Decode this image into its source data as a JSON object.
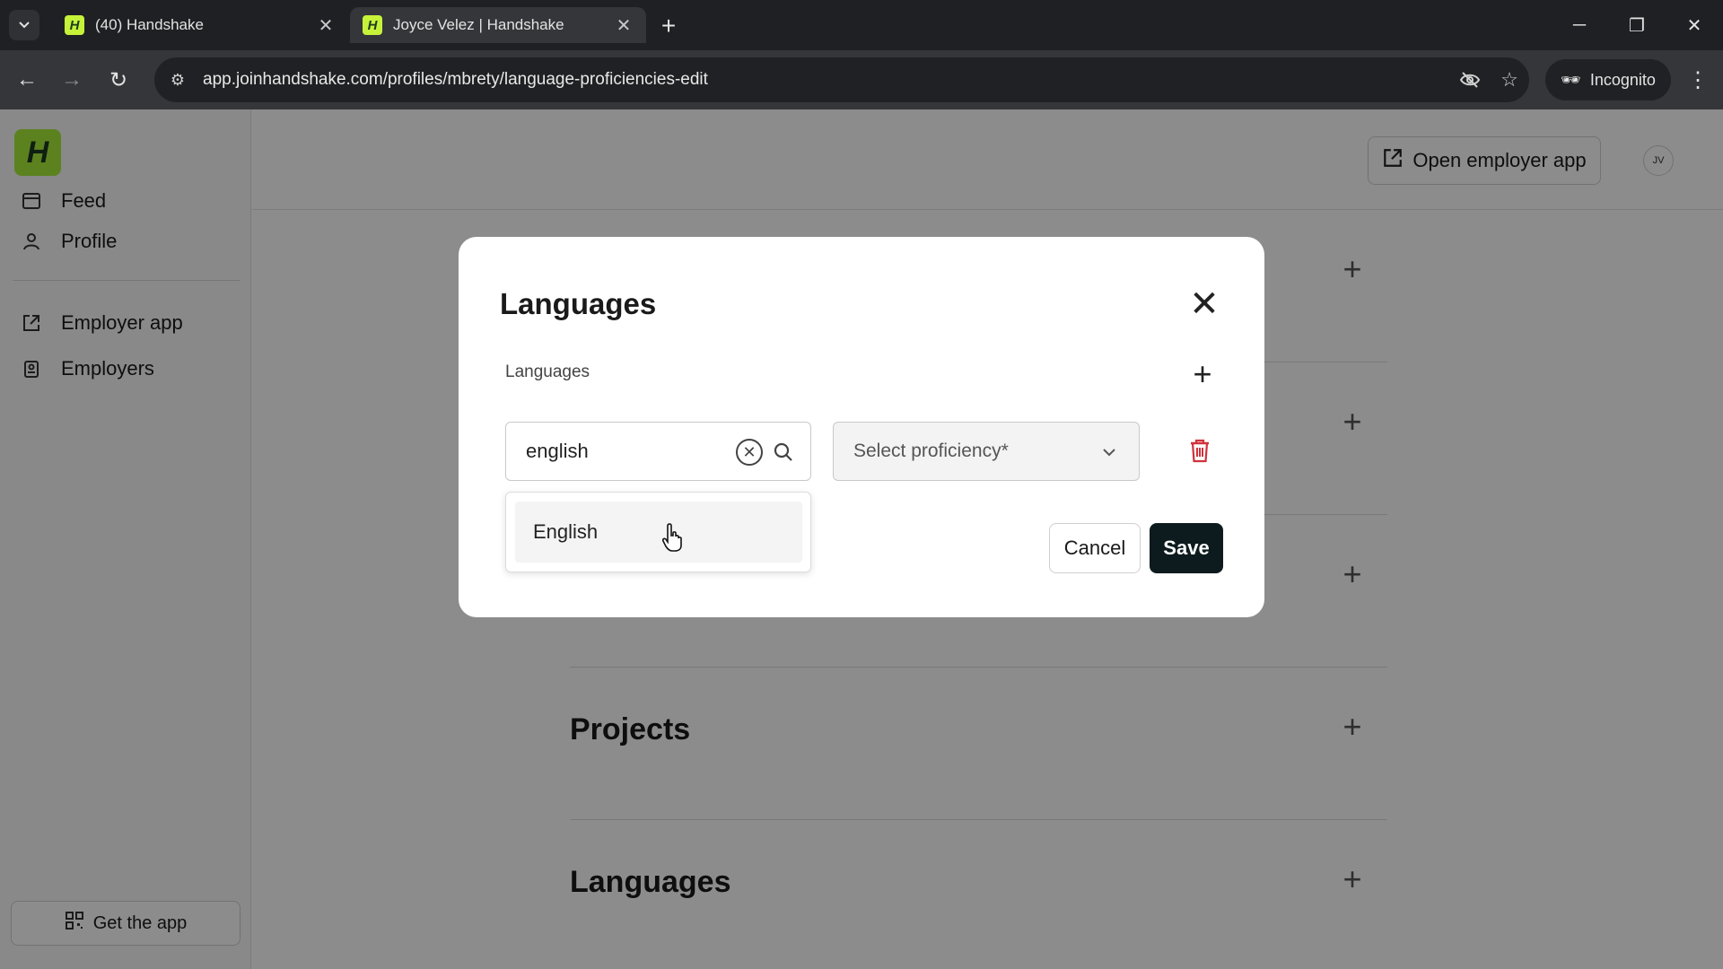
{
  "browser": {
    "tabs": [
      {
        "title": "(40) Handshake",
        "favicon": "H",
        "active": false
      },
      {
        "title": "Joyce Velez | Handshake",
        "favicon": "H",
        "active": true
      }
    ],
    "url": "app.joinhandshake.com/profiles/mbrety/language-proficiencies-edit",
    "incognito_label": "Incognito"
  },
  "sidebar": {
    "logo": "H",
    "items": [
      {
        "label": "Feed",
        "icon": "feed-icon"
      },
      {
        "label": "Profile",
        "icon": "person-icon"
      },
      {
        "label": "Employer app",
        "icon": "external-link-icon"
      },
      {
        "label": "Employers",
        "icon": "badge-icon"
      }
    ],
    "get_app": "Get the app"
  },
  "header": {
    "open_employer_app": "Open employer app",
    "avatar_initials": "JV"
  },
  "sections": [
    {
      "title": "Projects"
    },
    {
      "title": "Languages"
    }
  ],
  "modal": {
    "title": "Languages",
    "field_label": "Languages",
    "language_input_value": "english",
    "proficiency_placeholder": "Select proficiency*",
    "dropdown_options": [
      "English"
    ],
    "cancel": "Cancel",
    "save": "Save"
  },
  "colors": {
    "brand_green": "#a8ed3a",
    "save_button": "#0d1b1e",
    "delete_red": "#d0323b"
  }
}
